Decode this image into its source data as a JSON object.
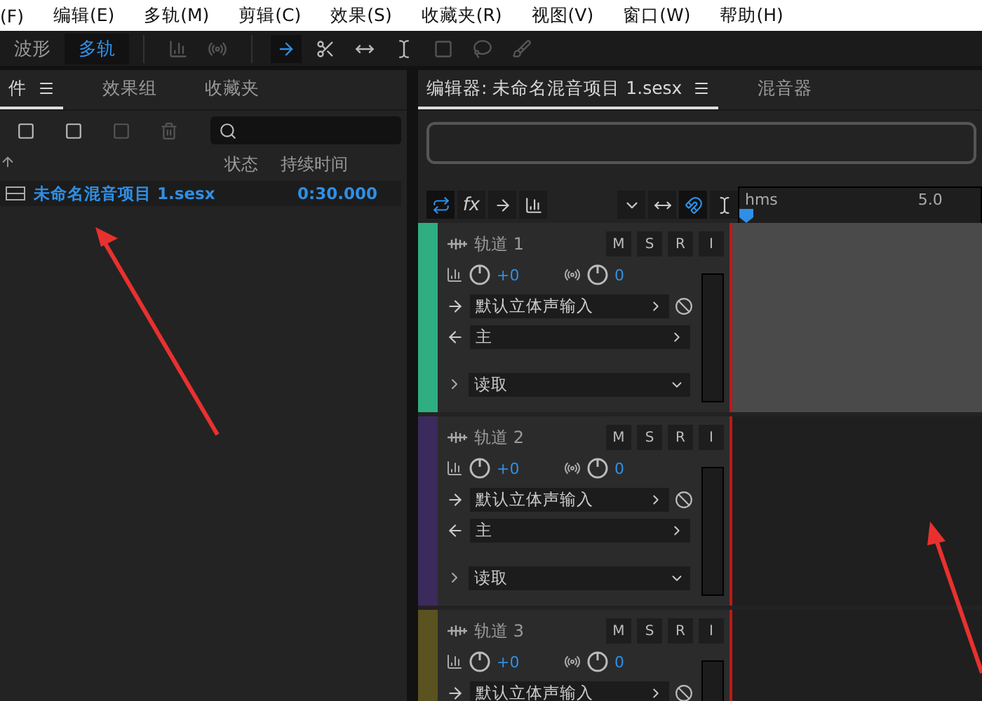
{
  "menu_bar": [
    "(F)",
    "编辑(E)",
    "多轨(M)",
    "剪辑(C)",
    "效果(S)",
    "收藏夹(R)",
    "视图(V)",
    "窗口(W)",
    "帮助(H)"
  ],
  "view_switch": [
    {
      "label": "波形",
      "selected": false
    },
    {
      "label": "多轨",
      "selected": true
    }
  ],
  "files_panel": {
    "tabs": [
      {
        "label": "件",
        "selected": true
      },
      {
        "label": "效果组",
        "selected": false
      },
      {
        "label": "收藏夹",
        "selected": false
      }
    ],
    "columns": [
      "状态",
      "持续时间"
    ],
    "rows": [
      {
        "name": "未命名混音项目 1.sesx",
        "duration": "0:30.000"
      }
    ]
  },
  "editor_panel": {
    "tabs": [
      {
        "label": "编辑器: 未命名混音项目 1.sesx",
        "selected": true
      },
      {
        "label": "混音器",
        "selected": false
      }
    ],
    "header_tools": {
      "fx": "fx"
    },
    "ruler": {
      "unit": "hms",
      "mark": "5.0"
    },
    "tracks": [
      {
        "buttons": [
          "M",
          "S",
          "R",
          "I"
        ],
        "name": "轨道 1",
        "color": "#2fae82",
        "selected": true,
        "volume": "+0",
        "pan": "0",
        "input": "默认立体声输入",
        "output": "主",
        "automation": "读取"
      },
      {
        "buttons": [
          "M",
          "S",
          "R",
          "I"
        ],
        "name": "轨道 2",
        "color": "#3b2a5c",
        "selected": false,
        "volume": "+0",
        "pan": "0",
        "input": "默认立体声输入",
        "output": "主",
        "automation": "读取"
      },
      {
        "buttons": [
          "M",
          "S",
          "R",
          "I"
        ],
        "name": "轨道 3",
        "color": "#5a5220",
        "selected": false,
        "volume": "+0",
        "pan": "0",
        "input": "默认立体声输入"
      }
    ]
  }
}
